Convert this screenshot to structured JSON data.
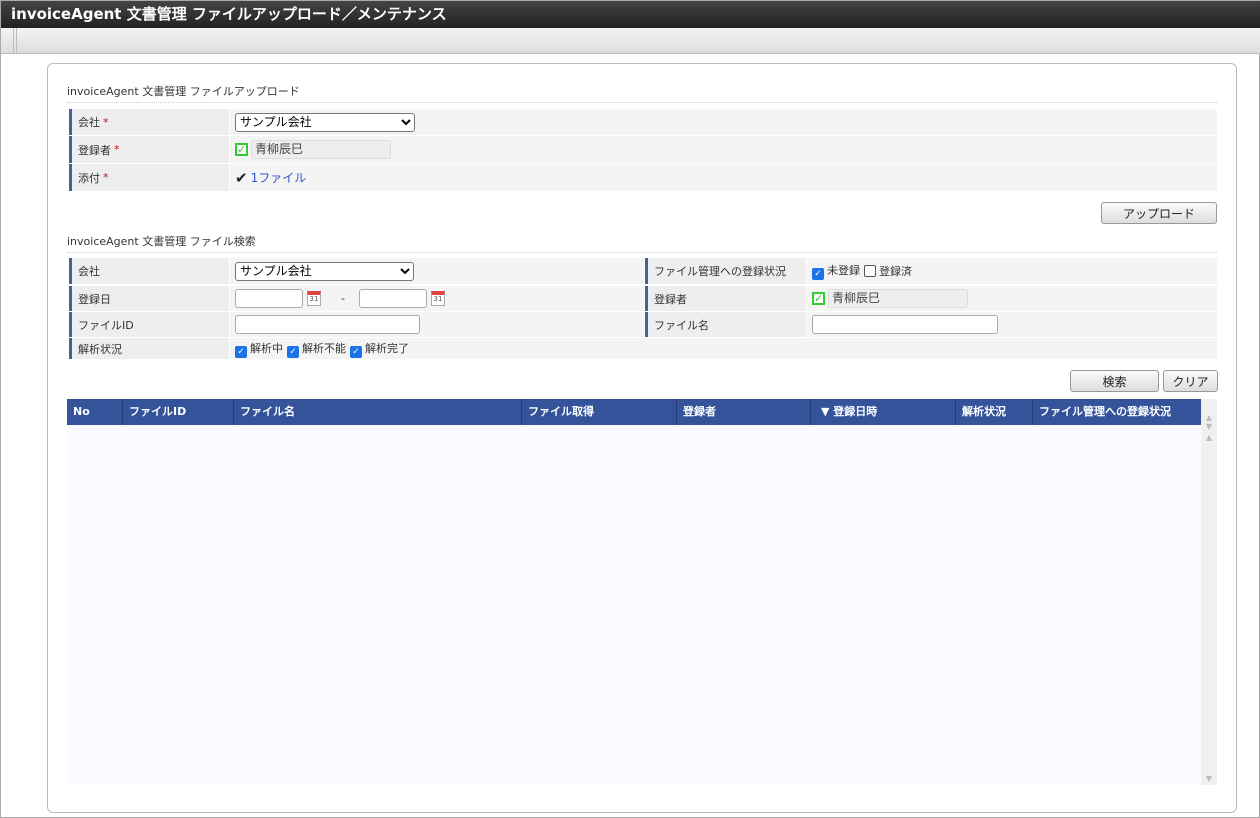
{
  "title": "invoiceAgent 文書管理 ファイルアップロード／メンテナンス",
  "upload": {
    "section_title": "invoiceAgent 文書管理 ファイルアップロード",
    "company_label": "会社",
    "company_value": "サンプル会社",
    "registrant_label": "登録者",
    "registrant_value": "青柳辰巳",
    "attach_label": "添付",
    "attach_value": "1ファイル",
    "required": "*",
    "upload_button": "アップロード"
  },
  "search": {
    "section_title": "invoiceAgent 文書管理 ファイル検索",
    "company_label": "会社",
    "company_value": "サンプル会社",
    "date_label": "登録日",
    "date_from": "",
    "date_to": "",
    "date_sep": "-",
    "cal_icon_text": "31",
    "fileid_label": "ファイルID",
    "fileid_value": "",
    "analysis_label": "解析状況",
    "analysis_options": [
      {
        "label": "解析中",
        "checked": true
      },
      {
        "label": "解析不能",
        "checked": true
      },
      {
        "label": "解析完了",
        "checked": true
      }
    ],
    "regstatus_label": "ファイル管理への登録状況",
    "regstatus_options": [
      {
        "label": "未登録",
        "checked": true
      },
      {
        "label": "登録済",
        "checked": false
      }
    ],
    "registrant_label": "登録者",
    "registrant_value": "青柳辰巳",
    "filename_label": "ファイル名",
    "filename_value": "",
    "search_button": "検索",
    "clear_button": "クリア"
  },
  "table": {
    "columns": [
      "No",
      "ファイルID",
      "ファイル名",
      "ファイル取得",
      "登録者",
      "▼ 登録日時",
      "解析状況",
      "ファイル管理への登録状況"
    ],
    "rows": []
  }
}
